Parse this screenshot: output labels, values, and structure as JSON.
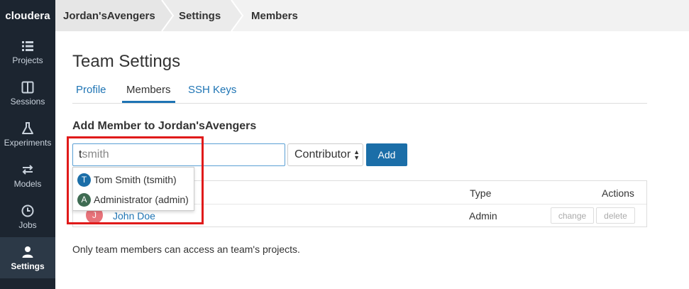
{
  "app": {
    "logo": "cloudera"
  },
  "sidebar": {
    "items": [
      {
        "label": "Projects",
        "icon": "list-icon"
      },
      {
        "label": "Sessions",
        "icon": "sessions-icon"
      },
      {
        "label": "Experiments",
        "icon": "flask-icon"
      },
      {
        "label": "Models",
        "icon": "arrows-icon"
      },
      {
        "label": "Jobs",
        "icon": "clock-icon"
      },
      {
        "label": "Settings",
        "icon": "user-icon",
        "active": true
      }
    ]
  },
  "breadcrumb": [
    "Jordan'sAvengers",
    "Settings",
    "Members"
  ],
  "page": {
    "title": "Team Settings",
    "tabs": [
      {
        "label": "Profile"
      },
      {
        "label": "Members",
        "active": true
      },
      {
        "label": "SSH Keys"
      }
    ],
    "add_member": {
      "title": "Add Member to Jordan'sAvengers",
      "search_value": "tsmith",
      "typed_prefix": "t",
      "role_value": "Contributor",
      "add_label": "Add"
    },
    "autocomplete": [
      {
        "initial": "T",
        "label": "Tom Smith (tsmith)",
        "color": "#1b6ea8"
      },
      {
        "initial": "A",
        "label": "Administrator (admin)",
        "color": "#3e6b52"
      }
    ],
    "table": {
      "headers": {
        "type": "Type",
        "actions": "Actions"
      },
      "rows": [
        {
          "initial": "J",
          "name": "John Doe",
          "type": "Admin",
          "change": "change",
          "delete": "delete"
        }
      ]
    },
    "footnote": "Only team members can access an team's projects."
  },
  "colors": {
    "accent": "#1e74b4",
    "sidebar": "#1c2530",
    "highlight": "#e01a1a"
  }
}
